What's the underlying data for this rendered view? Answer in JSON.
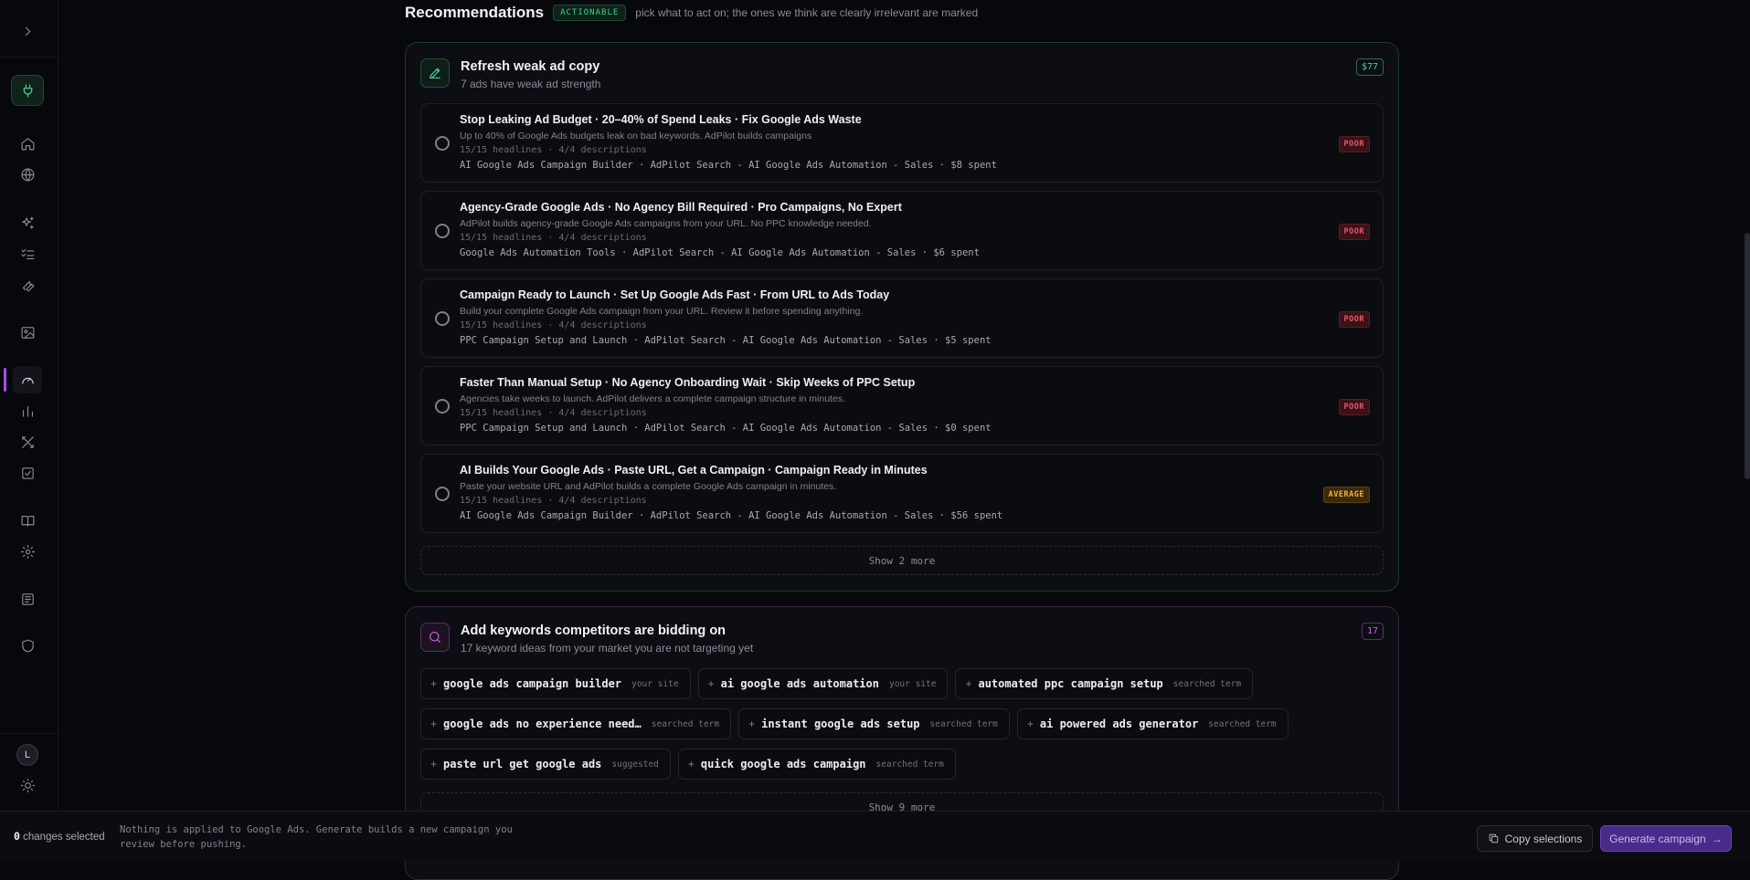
{
  "recommendations": {
    "title": "Recommendations",
    "badge": "ACTIONABLE",
    "subtitle": "pick what to act on; the ones we think are clearly irrelevant are marked"
  },
  "ad_copy": {
    "title": "Refresh weak ad copy",
    "subtitle": "7 ads have weak ad strength",
    "count": "$77",
    "ads": [
      {
        "title": "Stop Leaking Ad Budget · 20–40% of Spend Leaks · Fix Google Ads Waste",
        "description": "Up to 40% of Google Ads budgets leak on bad keywords. AdPilot builds campaigns",
        "meta": "15/15 headlines · 4/4 descriptions",
        "campaign": "AI Google Ads Campaign Builder · AdPilot Search - AI Google Ads Automation - Sales · $8 spent",
        "strength": "POOR"
      },
      {
        "title": "Agency-Grade Google Ads · No Agency Bill Required · Pro Campaigns, No Expert",
        "description": "AdPilot builds agency-grade Google Ads campaigns from your URL. No PPC knowledge needed.",
        "meta": "15/15 headlines · 4/4 descriptions",
        "campaign": "Google Ads Automation Tools · AdPilot Search - AI Google Ads Automation - Sales · $6 spent",
        "strength": "POOR"
      },
      {
        "title": "Campaign Ready to Launch · Set Up Google Ads Fast · From URL to Ads Today",
        "description": "Build your complete Google Ads campaign from your URL. Review it before spending anything.",
        "meta": "15/15 headlines · 4/4 descriptions",
        "campaign": "PPC Campaign Setup and Launch · AdPilot Search - AI Google Ads Automation - Sales · $5 spent",
        "strength": "POOR"
      },
      {
        "title": "Faster Than Manual Setup · No Agency Onboarding Wait · Skip Weeks of PPC Setup",
        "description": "Agencies take weeks to launch. AdPilot delivers a complete campaign structure in minutes.",
        "meta": "15/15 headlines · 4/4 descriptions",
        "campaign": "PPC Campaign Setup and Launch · AdPilot Search - AI Google Ads Automation - Sales · $0 spent",
        "strength": "POOR"
      },
      {
        "title": "AI Builds Your Google Ads · Paste URL, Get a Campaign · Campaign Ready in Minutes",
        "description": "Paste your website URL and AdPilot builds a complete Google Ads campaign in minutes.",
        "meta": "15/15 headlines · 4/4 descriptions",
        "campaign": "AI Google Ads Campaign Builder · AdPilot Search - AI Google Ads Automation - Sales · $56 spent",
        "strength": "AVERAGE"
      }
    ],
    "show_more": "Show 2 more"
  },
  "keywords": {
    "title": "Add keywords competitors are bidding on",
    "subtitle": "17 keyword ideas from your market you are not targeting yet",
    "count": "17",
    "rows": [
      [
        {
          "plus": "+",
          "text": "google ads campaign builder",
          "tag": "your site"
        },
        {
          "plus": "+",
          "text": "ai google ads automation",
          "tag": "your site"
        },
        {
          "plus": "+",
          "text": "automated ppc campaign setup",
          "tag": "searched term"
        }
      ],
      [
        {
          "plus": "+",
          "text": "google ads no experience need…",
          "tag": "searched term"
        },
        {
          "plus": "+",
          "text": "instant google ads setup",
          "tag": "searched term"
        },
        {
          "plus": "+",
          "text": "ai powered ads generator",
          "tag": "searched term"
        }
      ],
      [
        {
          "plus": "+",
          "text": "paste url get google ads",
          "tag": "suggested"
        },
        {
          "plus": "+",
          "text": "quick google ads campaign",
          "tag": "searched term"
        }
      ]
    ],
    "show_more": "Show 9 more"
  },
  "sidebar": {
    "avatar": "L",
    "icons": [
      "chevron-right-icon",
      "plug-icon",
      "home-icon",
      "globe-icon",
      "sparkles-icon",
      "list-checks-icon",
      "wrench-icon",
      "image-icon",
      "gauge-icon",
      "bar-chart-icon",
      "tools-icon",
      "check-square-icon",
      "book-icon",
      "gear-icon",
      "newspaper-icon",
      "shield-icon",
      "sun-icon"
    ]
  },
  "footer": {
    "count": "0",
    "count_label": " changes selected",
    "note": "Nothing is applied to Google Ads. Generate builds a new campaign you review before pushing.",
    "copy_label": "Copy selections",
    "generate_label": "Generate campaign",
    "generate_arrow": "→"
  },
  "colors": {
    "accent_green": "#38d18a",
    "accent_purple": "#a64cff",
    "poor": "#e4586a",
    "average": "#f0b13a"
  }
}
